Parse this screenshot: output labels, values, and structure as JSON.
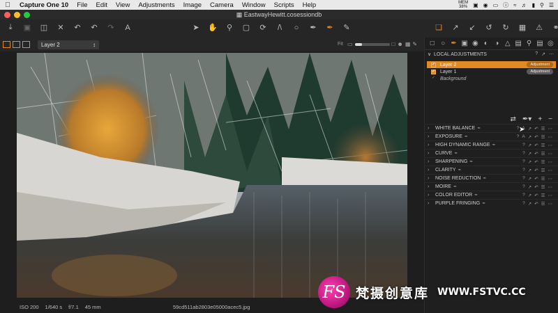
{
  "menubar": {
    "apple_icon": "apple-icon",
    "app_name": "Capture One 10",
    "items": [
      "File",
      "Edit",
      "View",
      "Adjustments",
      "Image",
      "Camera",
      "Window",
      "Scripts",
      "Help"
    ],
    "mem_label": "MEM",
    "mem_value": "38%"
  },
  "window": {
    "title": "EastwayHewitt.cosessiondb"
  },
  "viewbar": {
    "layer_select_value": "Layer 2",
    "fit_label": "Fit"
  },
  "status": {
    "iso": "ISO 200",
    "shutter": "1/640 s",
    "aperture": "f/7.1",
    "focal": "45 mm",
    "filename": "59cd511ab2803e05000acec5.jpg"
  },
  "panel": {
    "local_adjustments_title": "LOCAL ADJUSTMENTS",
    "layers": [
      {
        "name": "Layer 2",
        "badge": "Adjustment",
        "checked": true,
        "selected": true
      },
      {
        "name": "Layer 1",
        "badge": "Adjustment",
        "checked": true,
        "selected": false
      },
      {
        "name": "Background",
        "badge": "",
        "checked": true,
        "selected": false
      }
    ],
    "tools": [
      "WHITE BALANCE",
      "EXPOSURE",
      "HIGH DYNAMIC RANGE",
      "CURVE",
      "SHARPENING",
      "CLARITY",
      "NOISE REDUCTION",
      "MOIRE",
      "COLOR EDITOR",
      "PURPLE FRINGING"
    ]
  },
  "watermark": {
    "logo_text": "FS",
    "text": "梵摄创意库",
    "url": "WWW.FSTVC.CC"
  },
  "colors": {
    "accent": "#df8a22",
    "panel_bg": "#1f1f1f"
  }
}
